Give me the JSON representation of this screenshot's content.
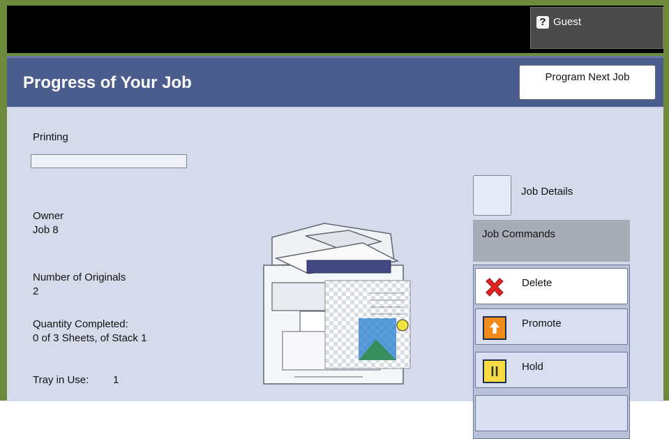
{
  "header": {
    "guest_label": "Guest"
  },
  "page": {
    "title": "Progress of Your Job",
    "program_next_label": "Program Next Job"
  },
  "job": {
    "status_label": "Printing",
    "progress": 0,
    "owner_label": "Owner",
    "owner_value": "Job 8",
    "originals_label": "Number of Originals",
    "originals_value": "2",
    "quantity_label": "Quantity Completed:",
    "quantity_value": "0 of 3 Sheets, of Stack 1",
    "tray_label": "Tray in Use:",
    "tray_value": "1"
  },
  "commands": {
    "details_label": "Job Details",
    "header": "Job Commands",
    "items": [
      {
        "label": "Delete"
      },
      {
        "label": "Promote"
      },
      {
        "label": "Hold"
      }
    ]
  },
  "icons": {
    "help": "question-icon",
    "delete": "delete-icon",
    "promote": "promote-icon",
    "hold": "hold-icon"
  }
}
